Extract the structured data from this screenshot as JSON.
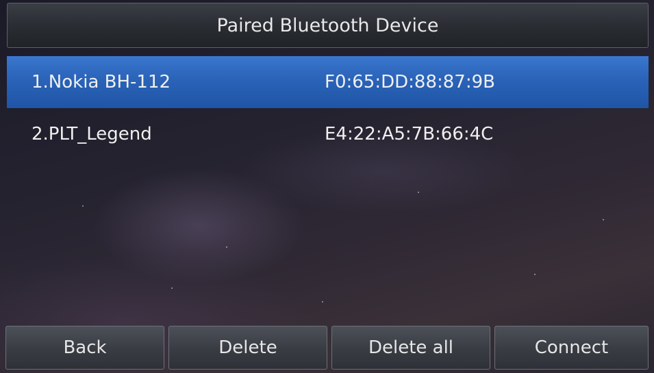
{
  "screen": {
    "title": "Paired Bluetooth Device"
  },
  "devices": [
    {
      "name": "1.Nokia BH-112",
      "address": "F0:65:DD:88:87:9B",
      "selected": true
    },
    {
      "name": "2.PLT_Legend",
      "address": "E4:22:A5:7B:66:4C",
      "selected": false
    }
  ],
  "softkeys": {
    "back": "Back",
    "delete": "Delete",
    "delete_all": "Delete all",
    "connect": "Connect"
  },
  "colors": {
    "selection": "#2a63b8",
    "background": "#1f1e2a",
    "text": "#f0f0f0"
  }
}
